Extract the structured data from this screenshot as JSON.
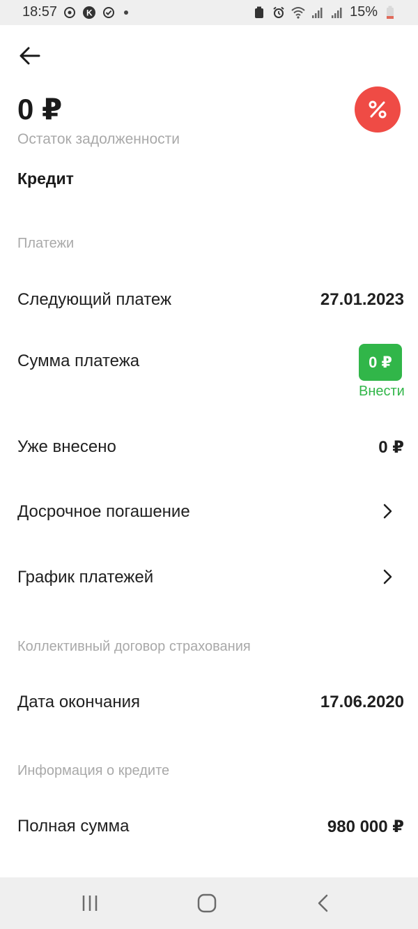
{
  "status_bar": {
    "time": "18:57",
    "battery": "15%",
    "icons_left": [
      "sync-icon",
      "k-icon",
      "check-icon",
      "dot-icon"
    ],
    "icons_right": [
      "battery-saver-icon",
      "alarm-icon",
      "wifi-icon",
      "signal-icon",
      "signal-icon"
    ]
  },
  "header": {
    "amount": "0 ₽",
    "amount_label": "Остаток задолженности",
    "product": "Кредит",
    "percent_icon": "percent-icon",
    "percent_color": "#ef4b45"
  },
  "payments": {
    "section_title": "Платежи",
    "next_payment_label": "Следующий платеж",
    "next_payment_value": "27.01.2023",
    "payment_sum_label": "Сумма платежа",
    "payment_sum_button": "0 ₽",
    "payment_sum_link": "Внести",
    "already_paid_label": "Уже внесено",
    "already_paid_value": "0 ₽",
    "early_repayment_label": "Досрочное погашение",
    "schedule_label": "График платежей",
    "accent_color": "#31b649"
  },
  "insurance": {
    "section_title": "Коллективный договор страхования",
    "end_date_label": "Дата окончания",
    "end_date_value": "17.06.2020"
  },
  "credit_info": {
    "section_title": "Информация о кредите",
    "full_sum_label": "Полная сумма",
    "full_sum_value": "980 000 ₽"
  },
  "nav": {
    "icons": [
      "recent-apps-icon",
      "home-icon",
      "back-icon"
    ]
  }
}
